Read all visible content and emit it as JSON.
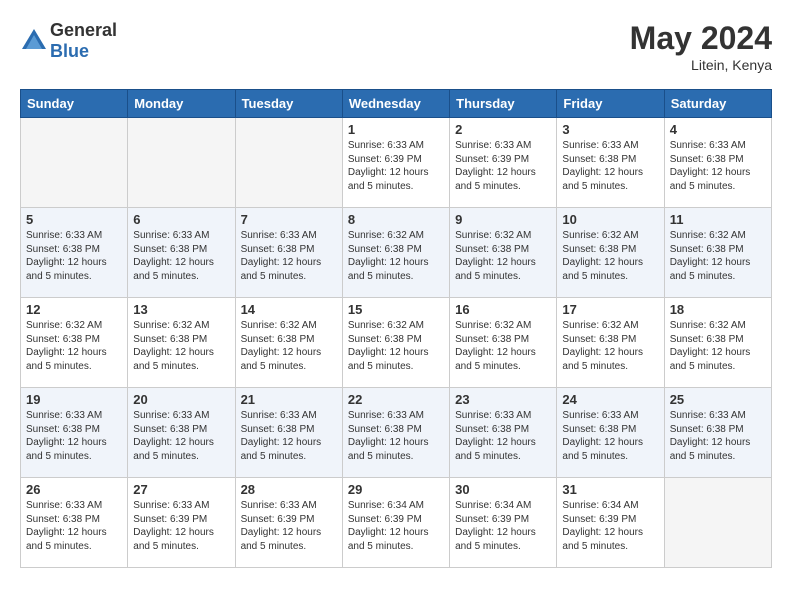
{
  "header": {
    "logo_line1": "General",
    "logo_line2": "Blue",
    "month_year": "May 2024",
    "location": "Litein, Kenya"
  },
  "days_of_week": [
    "Sunday",
    "Monday",
    "Tuesday",
    "Wednesday",
    "Thursday",
    "Friday",
    "Saturday"
  ],
  "weeks": [
    [
      {
        "day": "",
        "info": ""
      },
      {
        "day": "",
        "info": ""
      },
      {
        "day": "",
        "info": ""
      },
      {
        "day": "1",
        "info": "Sunrise: 6:33 AM\nSunset: 6:39 PM\nDaylight: 12 hours\nand 5 minutes."
      },
      {
        "day": "2",
        "info": "Sunrise: 6:33 AM\nSunset: 6:39 PM\nDaylight: 12 hours\nand 5 minutes."
      },
      {
        "day": "3",
        "info": "Sunrise: 6:33 AM\nSunset: 6:38 PM\nDaylight: 12 hours\nand 5 minutes."
      },
      {
        "day": "4",
        "info": "Sunrise: 6:33 AM\nSunset: 6:38 PM\nDaylight: 12 hours\nand 5 minutes."
      }
    ],
    [
      {
        "day": "5",
        "info": "Sunrise: 6:33 AM\nSunset: 6:38 PM\nDaylight: 12 hours\nand 5 minutes."
      },
      {
        "day": "6",
        "info": "Sunrise: 6:33 AM\nSunset: 6:38 PM\nDaylight: 12 hours\nand 5 minutes."
      },
      {
        "day": "7",
        "info": "Sunrise: 6:33 AM\nSunset: 6:38 PM\nDaylight: 12 hours\nand 5 minutes."
      },
      {
        "day": "8",
        "info": "Sunrise: 6:32 AM\nSunset: 6:38 PM\nDaylight: 12 hours\nand 5 minutes."
      },
      {
        "day": "9",
        "info": "Sunrise: 6:32 AM\nSunset: 6:38 PM\nDaylight: 12 hours\nand 5 minutes."
      },
      {
        "day": "10",
        "info": "Sunrise: 6:32 AM\nSunset: 6:38 PM\nDaylight: 12 hours\nand 5 minutes."
      },
      {
        "day": "11",
        "info": "Sunrise: 6:32 AM\nSunset: 6:38 PM\nDaylight: 12 hours\nand 5 minutes."
      }
    ],
    [
      {
        "day": "12",
        "info": "Sunrise: 6:32 AM\nSunset: 6:38 PM\nDaylight: 12 hours\nand 5 minutes."
      },
      {
        "day": "13",
        "info": "Sunrise: 6:32 AM\nSunset: 6:38 PM\nDaylight: 12 hours\nand 5 minutes."
      },
      {
        "day": "14",
        "info": "Sunrise: 6:32 AM\nSunset: 6:38 PM\nDaylight: 12 hours\nand 5 minutes."
      },
      {
        "day": "15",
        "info": "Sunrise: 6:32 AM\nSunset: 6:38 PM\nDaylight: 12 hours\nand 5 minutes."
      },
      {
        "day": "16",
        "info": "Sunrise: 6:32 AM\nSunset: 6:38 PM\nDaylight: 12 hours\nand 5 minutes."
      },
      {
        "day": "17",
        "info": "Sunrise: 6:32 AM\nSunset: 6:38 PM\nDaylight: 12 hours\nand 5 minutes."
      },
      {
        "day": "18",
        "info": "Sunrise: 6:32 AM\nSunset: 6:38 PM\nDaylight: 12 hours\nand 5 minutes."
      }
    ],
    [
      {
        "day": "19",
        "info": "Sunrise: 6:33 AM\nSunset: 6:38 PM\nDaylight: 12 hours\nand 5 minutes."
      },
      {
        "day": "20",
        "info": "Sunrise: 6:33 AM\nSunset: 6:38 PM\nDaylight: 12 hours\nand 5 minutes."
      },
      {
        "day": "21",
        "info": "Sunrise: 6:33 AM\nSunset: 6:38 PM\nDaylight: 12 hours\nand 5 minutes."
      },
      {
        "day": "22",
        "info": "Sunrise: 6:33 AM\nSunset: 6:38 PM\nDaylight: 12 hours\nand 5 minutes."
      },
      {
        "day": "23",
        "info": "Sunrise: 6:33 AM\nSunset: 6:38 PM\nDaylight: 12 hours\nand 5 minutes."
      },
      {
        "day": "24",
        "info": "Sunrise: 6:33 AM\nSunset: 6:38 PM\nDaylight: 12 hours\nand 5 minutes."
      },
      {
        "day": "25",
        "info": "Sunrise: 6:33 AM\nSunset: 6:38 PM\nDaylight: 12 hours\nand 5 minutes."
      }
    ],
    [
      {
        "day": "26",
        "info": "Sunrise: 6:33 AM\nSunset: 6:38 PM\nDaylight: 12 hours\nand 5 minutes."
      },
      {
        "day": "27",
        "info": "Sunrise: 6:33 AM\nSunset: 6:39 PM\nDaylight: 12 hours\nand 5 minutes."
      },
      {
        "day": "28",
        "info": "Sunrise: 6:33 AM\nSunset: 6:39 PM\nDaylight: 12 hours\nand 5 minutes."
      },
      {
        "day": "29",
        "info": "Sunrise: 6:34 AM\nSunset: 6:39 PM\nDaylight: 12 hours\nand 5 minutes."
      },
      {
        "day": "30",
        "info": "Sunrise: 6:34 AM\nSunset: 6:39 PM\nDaylight: 12 hours\nand 5 minutes."
      },
      {
        "day": "31",
        "info": "Sunrise: 6:34 AM\nSunset: 6:39 PM\nDaylight: 12 hours\nand 5 minutes."
      },
      {
        "day": "",
        "info": ""
      }
    ]
  ]
}
